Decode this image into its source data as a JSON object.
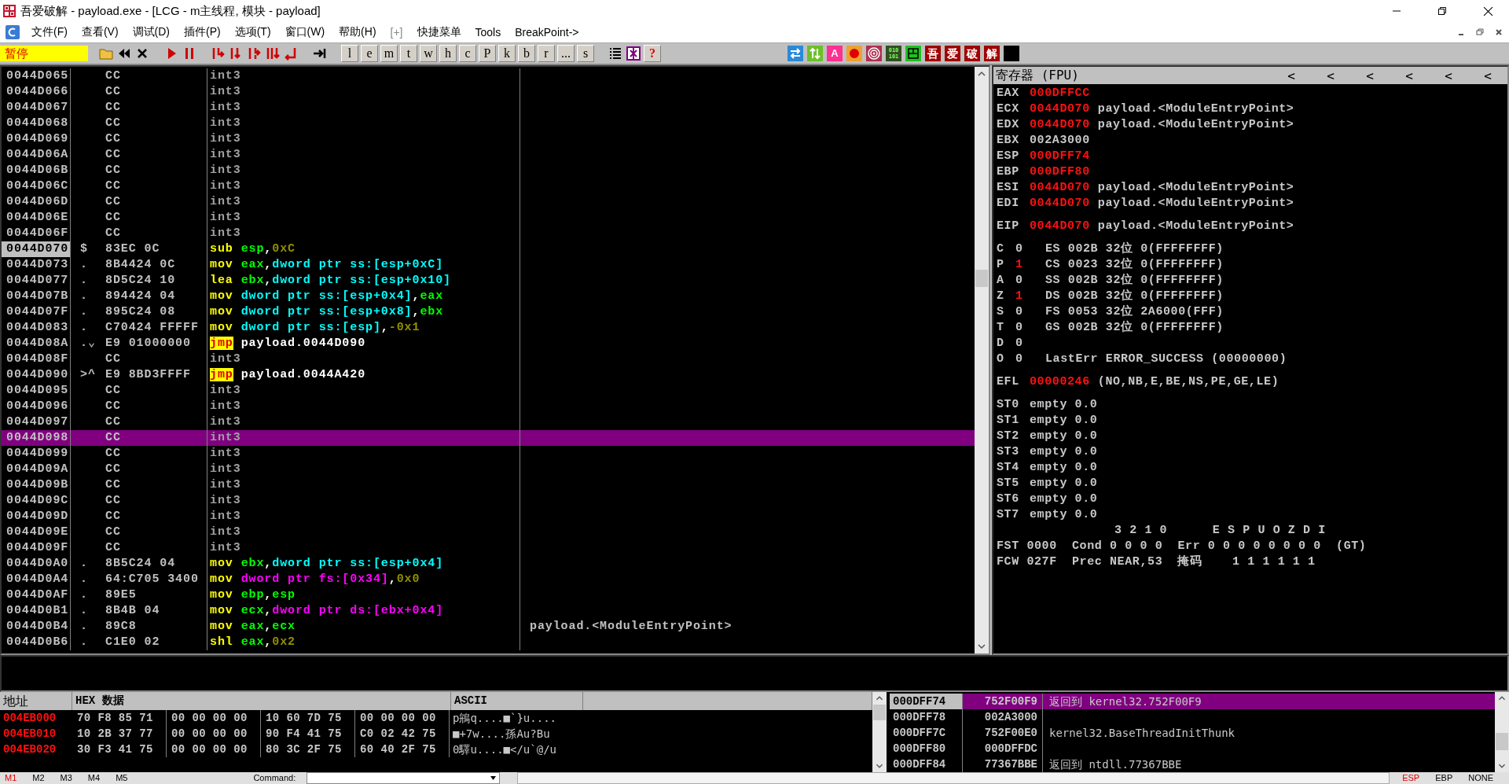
{
  "window": {
    "title": "吾爱破解 - payload.exe - [LCG - m主线程, 模块 - payload]"
  },
  "menu": [
    "文件(F)",
    "查看(V)",
    "调试(D)",
    "插件(P)",
    "选项(T)",
    "窗口(W)",
    "帮助(H)",
    "[+]",
    "快捷菜单",
    "Tools",
    "BreakPoint->"
  ],
  "toolbar": {
    "status": "暂停",
    "letter_buttons": [
      "l",
      "e",
      "m",
      "t",
      "w",
      "h",
      "c",
      "P",
      "k",
      "b",
      "r",
      "...",
      "s"
    ],
    "help_button": "?",
    "font_button": "A",
    "binary_button": [
      "010",
      "101"
    ],
    "brand_buttons": [
      "吾",
      "爱",
      "破",
      "解"
    ]
  },
  "disassembly": {
    "rows": [
      {
        "address": "0044D065",
        "hex": "CC",
        "mnemonic": {
          "text": "int3",
          "kind": "filler"
        },
        "operands": [],
        "selected": false,
        "current": false
      },
      {
        "address": "0044D066",
        "hex": "CC",
        "mnemonic": {
          "text": "int3",
          "kind": "filler"
        },
        "operands": [],
        "selected": false,
        "current": false
      },
      {
        "address": "0044D067",
        "hex": "CC",
        "mnemonic": {
          "text": "int3",
          "kind": "filler"
        },
        "operands": [],
        "selected": false,
        "current": false
      },
      {
        "address": "0044D068",
        "hex": "CC",
        "mnemonic": {
          "text": "int3",
          "kind": "filler"
        },
        "operands": [],
        "selected": false,
        "current": false
      },
      {
        "address": "0044D069",
        "hex": "CC",
        "mnemonic": {
          "text": "int3",
          "kind": "filler"
        },
        "operands": [],
        "selected": false,
        "current": false
      },
      {
        "address": "0044D06A",
        "hex": "CC",
        "mnemonic": {
          "text": "int3",
          "kind": "filler"
        },
        "operands": [],
        "selected": false,
        "current": false
      },
      {
        "address": "0044D06B",
        "hex": "CC",
        "mnemonic": {
          "text": "int3",
          "kind": "filler"
        },
        "operands": [],
        "selected": false,
        "current": false
      },
      {
        "address": "0044D06C",
        "hex": "CC",
        "mnemonic": {
          "text": "int3",
          "kind": "filler"
        },
        "operands": [],
        "selected": false,
        "current": false
      },
      {
        "address": "0044D06D",
        "hex": "CC",
        "mnemonic": {
          "text": "int3",
          "kind": "filler"
        },
        "operands": [],
        "selected": false,
        "current": false
      },
      {
        "address": "0044D06E",
        "hex": "CC",
        "mnemonic": {
          "text": "int3",
          "kind": "filler"
        },
        "operands": [],
        "selected": false,
        "current": false
      },
      {
        "address": "0044D06F",
        "hex": "CC",
        "mnemonic": {
          "text": "int3",
          "kind": "filler"
        },
        "operands": [],
        "selected": false,
        "current": false
      },
      {
        "address": "0044D070",
        "mark": "$",
        "hex": "83EC 0C",
        "mnemonic": {
          "text": "sub",
          "kind": "instr"
        },
        "operands": [
          {
            "text": "esp",
            "kind": "reg"
          },
          {
            "text": ",",
            "kind": "punct"
          },
          {
            "text": "0xC",
            "kind": "imm"
          }
        ],
        "selected": false,
        "current": true
      },
      {
        "address": "0044D073",
        "mark": ".",
        "hex": "8B4424 0C",
        "mnemonic": {
          "text": "mov",
          "kind": "instr"
        },
        "operands": [
          {
            "text": "eax",
            "kind": "reg"
          },
          {
            "text": ",",
            "kind": "punct"
          },
          {
            "text": "dword ptr ss:[esp+0xC]",
            "kind": "mem"
          }
        ],
        "selected": false,
        "current": false
      },
      {
        "address": "0044D077",
        "mark": ".",
        "hex": "8D5C24 10",
        "mnemonic": {
          "text": "lea",
          "kind": "instr"
        },
        "operands": [
          {
            "text": "ebx",
            "kind": "reg"
          },
          {
            "text": ",",
            "kind": "punct"
          },
          {
            "text": "dword ptr ss:[esp+0x10]",
            "kind": "mem"
          }
        ],
        "selected": false,
        "current": false
      },
      {
        "address": "0044D07B",
        "mark": ".",
        "hex": "894424 04",
        "mnemonic": {
          "text": "mov",
          "kind": "instr"
        },
        "operands": [
          {
            "text": "dword ptr ss:[esp+0x4]",
            "kind": "mem"
          },
          {
            "text": ",",
            "kind": "punct"
          },
          {
            "text": "eax",
            "kind": "reg"
          }
        ],
        "selected": false,
        "current": false
      },
      {
        "address": "0044D07F",
        "mark": ".",
        "hex": "895C24 08",
        "mnemonic": {
          "text": "mov",
          "kind": "instr"
        },
        "operands": [
          {
            "text": "dword ptr ss:[esp+0x8]",
            "kind": "mem"
          },
          {
            "text": ",",
            "kind": "punct"
          },
          {
            "text": "ebx",
            "kind": "reg"
          }
        ],
        "selected": false,
        "current": false
      },
      {
        "address": "0044D083",
        "mark": ".",
        "hex": "C70424 FFFFF",
        "mnemonic": {
          "text": "mov",
          "kind": "instr"
        },
        "operands": [
          {
            "text": "dword ptr ss:[esp]",
            "kind": "mem"
          },
          {
            "text": ",",
            "kind": "punct"
          },
          {
            "text": "-0x1",
            "kind": "imm"
          }
        ],
        "selected": false,
        "current": false
      },
      {
        "address": "0044D08A",
        "mark": ".⌄",
        "hex": "E9 01000000",
        "mnemonic": {
          "text": "jmp",
          "kind": "jump"
        },
        "operands": [
          {
            "text": "payload.0044D090",
            "kind": "label"
          }
        ],
        "selected": false,
        "current": false
      },
      {
        "address": "0044D08F",
        "hex": "CC",
        "mnemonic": {
          "text": "int3",
          "kind": "filler"
        },
        "operands": [],
        "selected": false,
        "current": false
      },
      {
        "address": "0044D090",
        "mark": ">^",
        "hex": "E9 8BD3FFFF",
        "mnemonic": {
          "text": "jmp",
          "kind": "jump"
        },
        "operands": [
          {
            "text": "payload.0044A420",
            "kind": "label"
          }
        ],
        "selected": false,
        "current": false
      },
      {
        "address": "0044D095",
        "hex": "CC",
        "mnemonic": {
          "text": "int3",
          "kind": "filler"
        },
        "operands": [],
        "selected": false,
        "current": false
      },
      {
        "address": "0044D096",
        "hex": "CC",
        "mnemonic": {
          "text": "int3",
          "kind": "filler"
        },
        "operands": [],
        "selected": false,
        "current": false
      },
      {
        "address": "0044D097",
        "hex": "CC",
        "mnemonic": {
          "text": "int3",
          "kind": "filler"
        },
        "operands": [],
        "selected": false,
        "current": false
      },
      {
        "address": "0044D098",
        "hex": "CC",
        "mnemonic": {
          "text": "int3",
          "kind": "filler"
        },
        "operands": [],
        "selected": true,
        "current": false
      },
      {
        "address": "0044D099",
        "hex": "CC",
        "mnemonic": {
          "text": "int3",
          "kind": "filler"
        },
        "operands": [],
        "selected": false,
        "current": false
      },
      {
        "address": "0044D09A",
        "hex": "CC",
        "mnemonic": {
          "text": "int3",
          "kind": "filler"
        },
        "operands": [],
        "selected": false,
        "current": false
      },
      {
        "address": "0044D09B",
        "hex": "CC",
        "mnemonic": {
          "text": "int3",
          "kind": "filler"
        },
        "operands": [],
        "selected": false,
        "current": false
      },
      {
        "address": "0044D09C",
        "hex": "CC",
        "mnemonic": {
          "text": "int3",
          "kind": "filler"
        },
        "operands": [],
        "selected": false,
        "current": false
      },
      {
        "address": "0044D09D",
        "hex": "CC",
        "mnemonic": {
          "text": "int3",
          "kind": "filler"
        },
        "operands": [],
        "selected": false,
        "current": false
      },
      {
        "address": "0044D09E",
        "hex": "CC",
        "mnemonic": {
          "text": "int3",
          "kind": "filler"
        },
        "operands": [],
        "selected": false,
        "current": false
      },
      {
        "address": "0044D09F",
        "hex": "CC",
        "mnemonic": {
          "text": "int3",
          "kind": "filler"
        },
        "operands": [],
        "selected": false,
        "current": false
      },
      {
        "address": "0044D0A0",
        "mark": ".",
        "hex": "8B5C24 04",
        "mnemonic": {
          "text": "mov",
          "kind": "instr"
        },
        "operands": [
          {
            "text": "ebx",
            "kind": "reg"
          },
          {
            "text": ",",
            "kind": "punct"
          },
          {
            "text": "dword ptr ss:[esp+0x4]",
            "kind": "mem"
          }
        ],
        "selected": false,
        "current": false
      },
      {
        "address": "0044D0A4",
        "mark": ".",
        "hex": "64:C705 3400",
        "mnemonic": {
          "text": "mov",
          "kind": "instr"
        },
        "operands": [
          {
            "text": "dword ptr fs:[0x34]",
            "kind": "segmem"
          },
          {
            "text": ",",
            "kind": "punct"
          },
          {
            "text": "0x0",
            "kind": "imm"
          }
        ],
        "selected": false,
        "current": false
      },
      {
        "address": "0044D0AF",
        "mark": ".",
        "hex": "89E5",
        "mnemonic": {
          "text": "mov",
          "kind": "instr"
        },
        "operands": [
          {
            "text": "ebp",
            "kind": "reg"
          },
          {
            "text": ",",
            "kind": "punct"
          },
          {
            "text": "esp",
            "kind": "reg"
          }
        ],
        "selected": false,
        "current": false
      },
      {
        "address": "0044D0B1",
        "mark": ".",
        "hex": "8B4B 04",
        "mnemonic": {
          "text": "mov",
          "kind": "instr"
        },
        "operands": [
          {
            "text": "ecx",
            "kind": "reg"
          },
          {
            "text": ",",
            "kind": "punct"
          },
          {
            "text": "dword ptr ds:[ebx+0x4]",
            "kind": "segmem"
          }
        ],
        "selected": false,
        "current": false
      },
      {
        "address": "0044D0B4",
        "mark": ".",
        "hex": "89C8",
        "mnemonic": {
          "text": "mov",
          "kind": "instr"
        },
        "operands": [
          {
            "text": "eax",
            "kind": "reg"
          },
          {
            "text": ",",
            "kind": "punct"
          },
          {
            "text": "ecx",
            "kind": "reg"
          }
        ],
        "comment": "payload.<ModuleEntryPoint>",
        "selected": false,
        "current": false
      },
      {
        "address": "0044D0B6",
        "mark": ".",
        "hex": "C1E0 02",
        "mnemonic": {
          "text": "shl",
          "kind": "instr"
        },
        "operands": [
          {
            "text": "eax",
            "kind": "reg"
          },
          {
            "text": ",",
            "kind": "punct"
          },
          {
            "text": "0x2",
            "kind": "imm"
          }
        ],
        "selected": false,
        "current": false
      }
    ]
  },
  "registers": {
    "title": "寄存器 (FPU)",
    "arrows": [
      "<",
      "<",
      "<",
      "<",
      "<",
      "<"
    ],
    "general": [
      {
        "name": "EAX",
        "value": "000DFFCC",
        "changed": true
      },
      {
        "name": "ECX",
        "value": "0044D070",
        "changed": true,
        "comment": "payload.<ModuleEntryPoint>"
      },
      {
        "name": "EDX",
        "value": "0044D070",
        "changed": true,
        "comment": "payload.<ModuleEntryPoint>"
      },
      {
        "name": "EBX",
        "value": "002A3000",
        "changed": false
      },
      {
        "name": "ESP",
        "value": "000DFF74",
        "changed": true
      },
      {
        "name": "EBP",
        "value": "000DFF80",
        "changed": true
      },
      {
        "name": "ESI",
        "value": "0044D070",
        "changed": true,
        "comment": "payload.<ModuleEntryPoint>"
      },
      {
        "name": "EDI",
        "value": "0044D070",
        "changed": true,
        "comment": "payload.<ModuleEntryPoint>"
      }
    ],
    "eip": {
      "name": "EIP",
      "value": "0044D070",
      "changed": true,
      "comment": "payload.<ModuleEntryPoint>"
    },
    "flags": [
      {
        "name": "C",
        "value": "0",
        "changed": false,
        "info": "ES 002B 32位 0(FFFFFFFF)"
      },
      {
        "name": "P",
        "value": "1",
        "changed": true,
        "info": "CS 0023 32位 0(FFFFFFFF)"
      },
      {
        "name": "A",
        "value": "0",
        "changed": false,
        "info": "SS 002B 32位 0(FFFFFFFF)"
      },
      {
        "name": "Z",
        "value": "1",
        "changed": true,
        "info": "DS 002B 32位 0(FFFFFFFF)"
      },
      {
        "name": "S",
        "value": "0",
        "changed": false,
        "info": "FS 0053 32位 2A6000(FFF)"
      },
      {
        "name": "T",
        "value": "0",
        "changed": false,
        "info": "GS 002B 32位 0(FFFFFFFF)"
      },
      {
        "name": "D",
        "value": "0",
        "changed": false
      },
      {
        "name": "O",
        "value": "0",
        "changed": false,
        "info": "LastErr ERROR_SUCCESS (00000000)"
      }
    ],
    "efl": {
      "name": "EFL",
      "value": "00000246",
      "changed": true,
      "comment": "(NO,NB,E,BE,NS,PE,GE,LE)"
    },
    "fpu": [
      {
        "name": "ST0",
        "value": "empty 0.0"
      },
      {
        "name": "ST1",
        "value": "empty 0.0"
      },
      {
        "name": "ST2",
        "value": "empty 0.0"
      },
      {
        "name": "ST3",
        "value": "empty 0.0"
      },
      {
        "name": "ST4",
        "value": "empty 0.0"
      },
      {
        "name": "ST5",
        "value": "empty 0.0"
      },
      {
        "name": "ST6",
        "value": "empty 0.0"
      },
      {
        "name": "ST7",
        "value": "empty 0.0"
      }
    ],
    "fpu_header": "3 2 1 0      E S P U O Z D I",
    "fpu_lines": [
      "FST 0000  Cond 0 0 0 0  Err 0 0 0 0 0 0 0 0  (GT)",
      "FCW 027F  Prec NEAR,53  掩码    1 1 1 1 1 1"
    ]
  },
  "dump": {
    "columns": [
      "地址",
      "HEX 数据",
      "ASCII"
    ],
    "rows": [
      {
        "address": "004EB000",
        "hex": [
          "70 F8 85 71",
          "00 00 00 00",
          "10 60 7D 75",
          "00 00 00 00"
        ],
        "ascii": "p鴘q....■`}u...."
      },
      {
        "address": "004EB010",
        "hex": [
          "10 2B 37 77",
          "00 00 00 00",
          "90 F4 41 75",
          "C0 02 42 75"
        ],
        "ascii": "■+7w....孫Au?Bu"
      },
      {
        "address": "004EB020",
        "hex": [
          "30 F3 41 75",
          "00 00 00 00",
          "80 3C 2F 75",
          "60 40 2F 75"
        ],
        "ascii": "0驛u....■</u`@/u"
      }
    ]
  },
  "stack": {
    "rows": [
      {
        "address": "000DFF74",
        "value": "752F00F9",
        "comment": "返回到 kernel32.752F00F9",
        "selected": true
      },
      {
        "address": "000DFF78",
        "value": "002A3000",
        "selected": false
      },
      {
        "address": "000DFF7C",
        "value": "752F00E0",
        "comment": "kernel32.BaseThreadInitThunk",
        "selected": false
      },
      {
        "address": "000DFF80",
        "value": "000DFFDC",
        "selected": false
      },
      {
        "address": "000DFF84",
        "value": "77367BBE",
        "comment": "返回到 ntdll.77367BBE",
        "selected": false
      }
    ]
  },
  "status_bar": {
    "marks": [
      {
        "label": "M1",
        "selected": true
      },
      {
        "label": "M2",
        "selected": false
      },
      {
        "label": "M3",
        "selected": false
      },
      {
        "label": "M4",
        "selected": false
      },
      {
        "label": "M5",
        "selected": false
      }
    ],
    "command_label": "Command:",
    "modes": [
      {
        "label": "ESP",
        "selected": true
      },
      {
        "label": "EBP",
        "selected": false
      },
      {
        "label": "NONE",
        "selected": false
      }
    ]
  }
}
